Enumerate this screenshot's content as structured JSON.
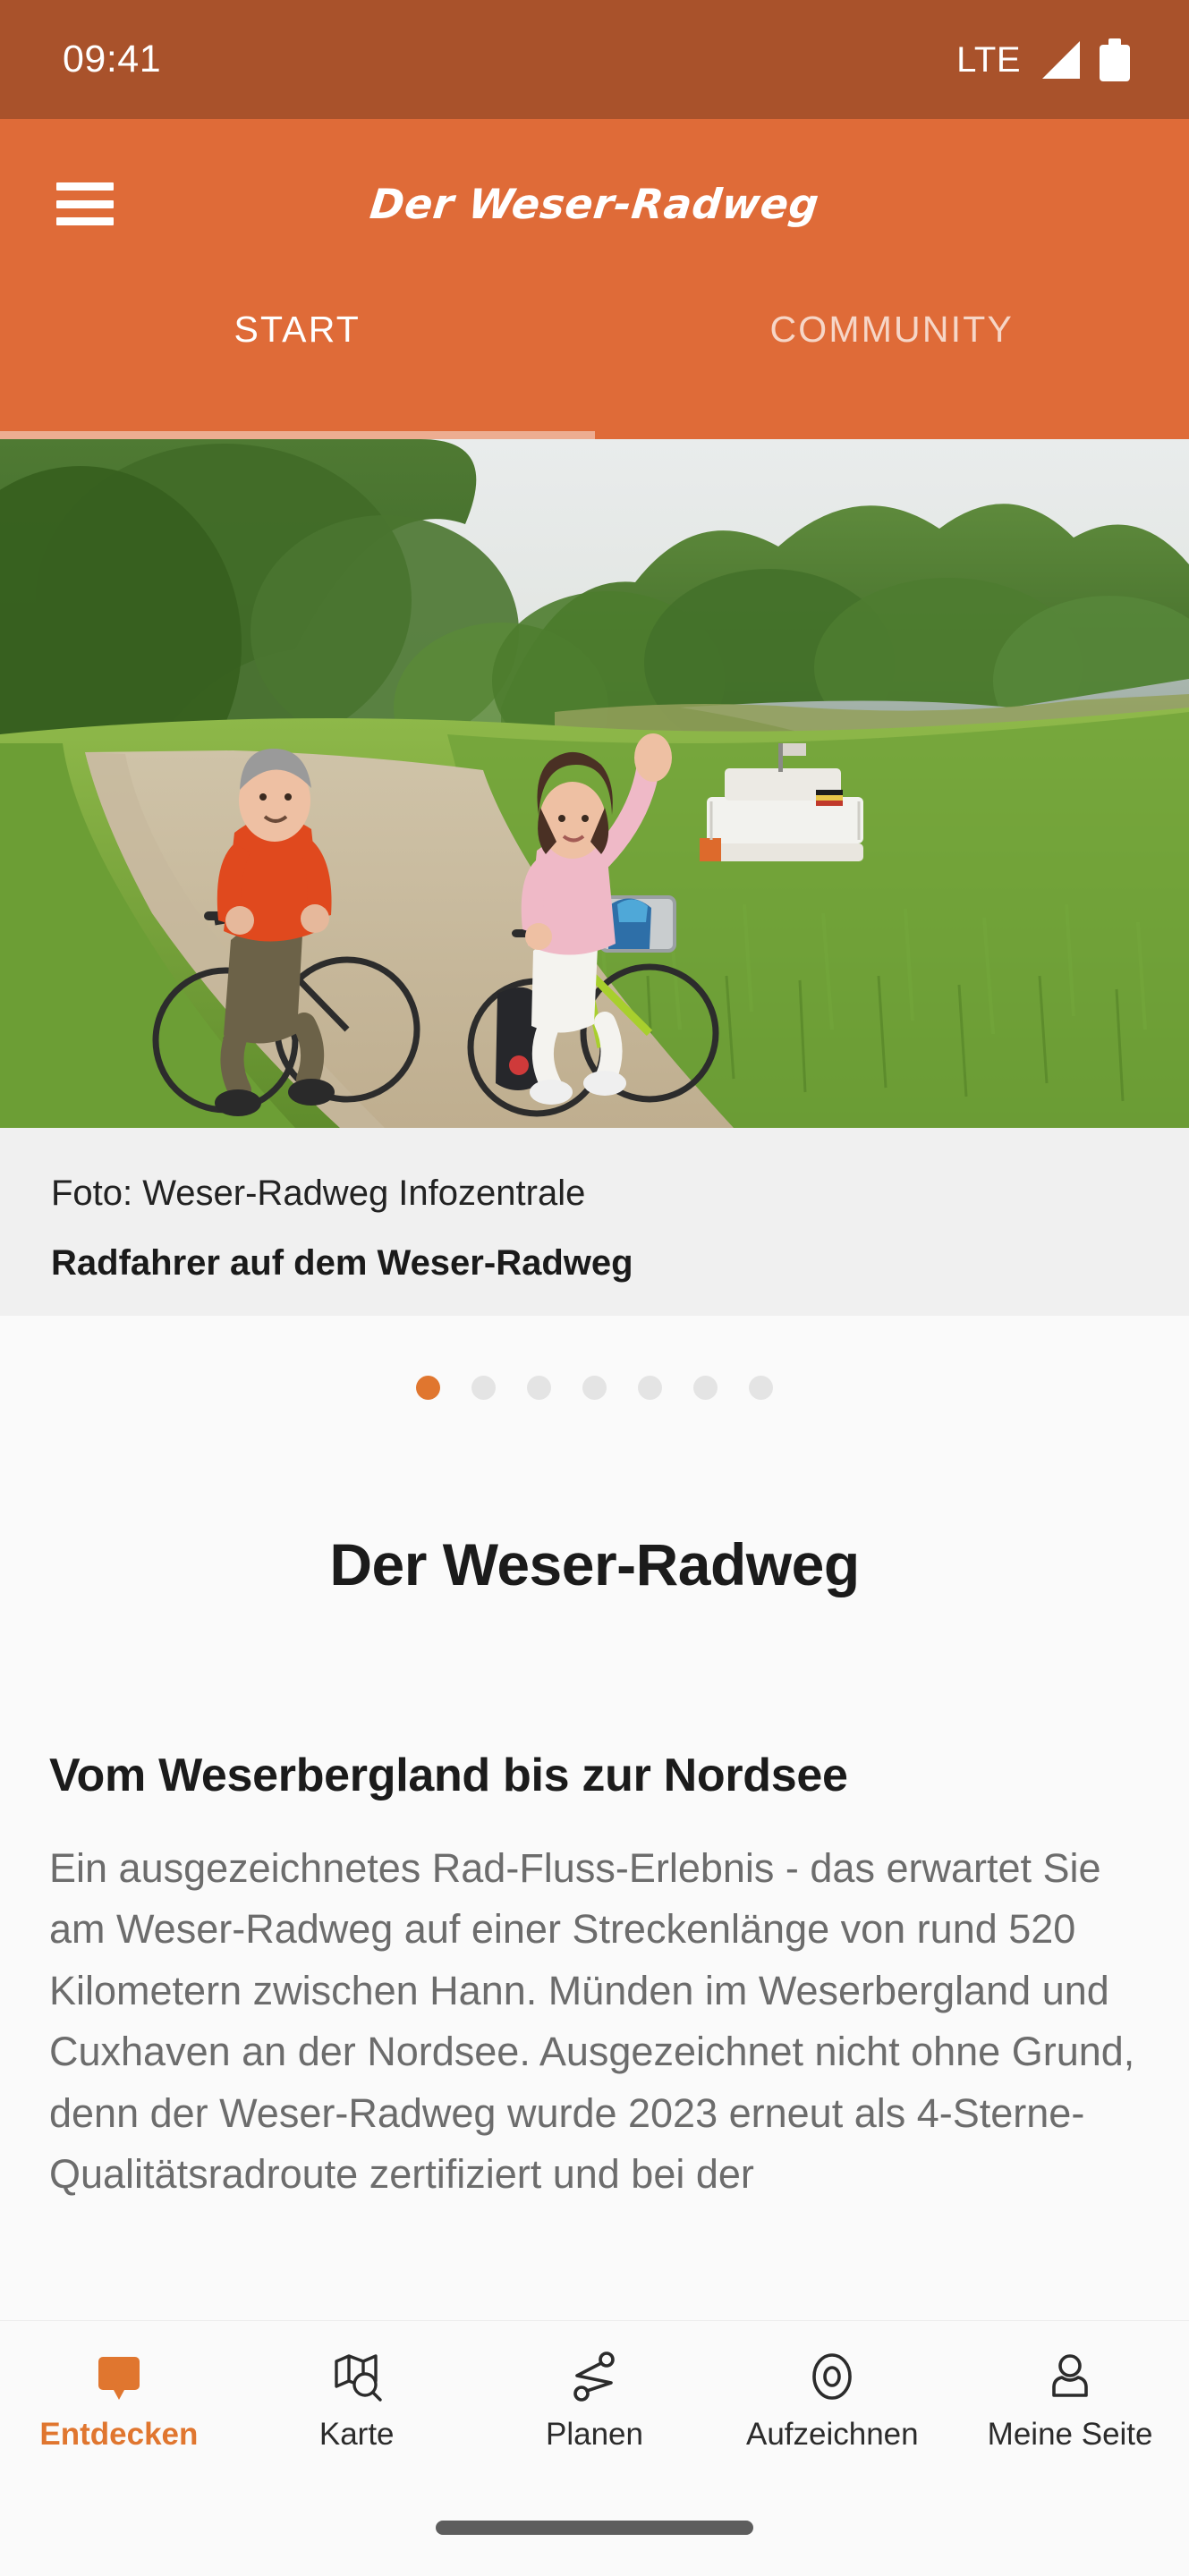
{
  "status_bar": {
    "time": "09:41",
    "network": "LTE",
    "signal_icon": "signal-triangle-icon",
    "battery_icon": "battery-full-icon",
    "background_color": "#a9522b"
  },
  "app_bar": {
    "menu_icon": "hamburger-menu-icon",
    "logo_text": "Der Weser-Radweg",
    "background_color": "#df6b38",
    "tabs": [
      {
        "label": "START",
        "active": true
      },
      {
        "label": "COMMUNITY",
        "active": false
      }
    ]
  },
  "hero": {
    "alt": "Radfahrer auf dem Weser-Radweg",
    "caption_credit": "Foto: Weser-Radweg Infozentrale",
    "caption_title": "Radfahrer auf dem Weser-Radweg"
  },
  "carousel": {
    "total_dots": 7,
    "active_index": 0,
    "active_color": "#e0762f",
    "inactive_color": "#e4e4e4"
  },
  "article": {
    "page_title": "Der Weser-Radweg",
    "sub_title": "Vom Weserbergland bis zur Nordsee",
    "body": "Ein ausgezeichnetes Rad-Fluss-Erlebnis - das erwartet Sie am Weser-Radweg auf einer Streckenlänge von rund 520 Kilometern zwischen Hann. Münden im Weserbergland und Cuxhaven an der Nordsee. Ausgezeichnet nicht ohne Grund, denn der Weser-Radweg wurde 2023 erneut als 4-Sterne-Qualitätsradroute zertifiziert und bei der"
  },
  "bottom_nav": {
    "accent_color": "#e0762f",
    "items": [
      {
        "label": "Entdecken",
        "icon": "map-pin-icon",
        "active": true
      },
      {
        "label": "Karte",
        "icon": "map-search-icon",
        "active": false
      },
      {
        "label": "Planen",
        "icon": "route-icon",
        "active": false
      },
      {
        "label": "Aufzeichnen",
        "icon": "record-circle-icon",
        "active": false
      },
      {
        "label": "Meine Seite",
        "icon": "person-icon",
        "active": false
      }
    ]
  },
  "home_indicator": {
    "present": true
  }
}
